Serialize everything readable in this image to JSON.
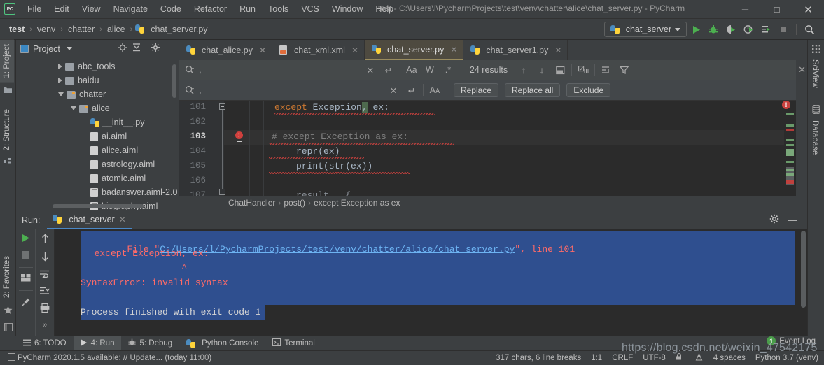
{
  "titlebar": {
    "logo": "PC",
    "menus": [
      "File",
      "Edit",
      "View",
      "Navigate",
      "Code",
      "Refactor",
      "Run",
      "Tools",
      "VCS",
      "Window",
      "Help"
    ],
    "window_title": "test - C:\\Users\\l\\PycharmProjects\\test\\venv\\chatter\\alice\\chat_server.py - PyCharm",
    "minimize": "─",
    "maximize": "□",
    "close": "✕"
  },
  "navbar": {
    "crumbs": [
      "test",
      "venv",
      "chatter",
      "alice",
      "chat_server.py"
    ],
    "separator": "›",
    "run_config": "chat_server",
    "tools": [
      "run-icon",
      "debug-icon",
      "run-coverage-icon",
      "profile-icon",
      "run-with-console-icon",
      "stop-icon",
      "search-everywhere-icon"
    ]
  },
  "left_strip": {
    "project_tab": "1: Project",
    "structure_tab": "2: Structure",
    "favorites_tab": "2: Favorites"
  },
  "project_panel": {
    "title": "Project",
    "header_icons": [
      "locate-icon",
      "collapse-all-icon",
      "settings-icon",
      "hide-icon"
    ],
    "tree": [
      {
        "label": "abc_tools",
        "indent": 2,
        "arrow": "right",
        "icon": "folder-icon"
      },
      {
        "label": "baidu",
        "indent": 2,
        "arrow": "right",
        "icon": "folder-icon"
      },
      {
        "label": "chatter",
        "indent": 2,
        "arrow": "down",
        "icon": "source-folder-icon"
      },
      {
        "label": "alice",
        "indent": 3,
        "arrow": "down",
        "icon": "source-folder-icon"
      },
      {
        "label": "__init__.py",
        "indent": 4,
        "arrow": "none",
        "icon": "python-file-icon"
      },
      {
        "label": "ai.aiml",
        "indent": 4,
        "arrow": "none",
        "icon": "aiml-file-icon"
      },
      {
        "label": "alice.aiml",
        "indent": 4,
        "arrow": "none",
        "icon": "aiml-file-icon"
      },
      {
        "label": "astrology.aiml",
        "indent": 4,
        "arrow": "none",
        "icon": "aiml-file-icon"
      },
      {
        "label": "atomic.aiml",
        "indent": 4,
        "arrow": "none",
        "icon": "aiml-file-icon"
      },
      {
        "label": "badanswer.aiml-2.0",
        "indent": 4,
        "arrow": "none",
        "icon": "aiml-file-icon"
      },
      {
        "label": "biography.aiml",
        "indent": 4,
        "arrow": "none",
        "icon": "aiml-file-icon"
      }
    ]
  },
  "editor_tabs": [
    {
      "label": "chat_alice.py",
      "icon": "python-file-icon",
      "active": false
    },
    {
      "label": "chat_xml.xml",
      "icon": "xml-file-icon",
      "active": false
    },
    {
      "label": "chat_server.py",
      "icon": "python-file-icon",
      "active": true
    },
    {
      "label": "chat_server1.py",
      "icon": "python-file-icon",
      "active": false
    }
  ],
  "find_bar": {
    "search_value": ",",
    "search_placeholder": "",
    "match_case": "Aa",
    "words": "W",
    "regex": ".*",
    "results": "24 results",
    "prev": "↑",
    "next": "↓",
    "preserve_case": "Aᴀ"
  },
  "replace_bar": {
    "replace_value": ",",
    "replace_btn": "Replace",
    "replace_all_btn": "Replace all",
    "exclude_btn": "Exclude"
  },
  "editor": {
    "lines": [
      {
        "num": "101",
        "text": "except Exception, ex:",
        "current": false
      },
      {
        "num": "102",
        "text": "",
        "current": false
      },
      {
        "num": "103",
        "text": "# except Exception as ex:",
        "current": true
      },
      {
        "num": "104",
        "text": "repr(ex)",
        "current": false
      },
      {
        "num": "105",
        "text": "print(str(ex))",
        "current": false
      },
      {
        "num": "106",
        "text": "",
        "current": false
      },
      {
        "num": "107",
        "text": "result = {",
        "current": false
      }
    ],
    "breadcrumbs": [
      "ChatHandler",
      "post()",
      "except Exception as ex"
    ],
    "breadcrumb_sep": "›"
  },
  "right_strip": {
    "sciview_tab": "SciView",
    "database_tab": "Database"
  },
  "run_panel": {
    "label": "Run:",
    "tab": "chat_server",
    "console": [
      {
        "text": "  File \"C:/Users/l/PycharmProjects/test/venv/chatter/alice/chat_server.py\", line 101",
        "kind": "error-file"
      },
      {
        "text": "    except Exception, ex:",
        "kind": "error"
      },
      {
        "text": "                    ^",
        "kind": "error"
      },
      {
        "text": "SyntaxError: invalid syntax",
        "kind": "error"
      },
      {
        "text": "",
        "kind": "blank"
      },
      {
        "text": "Process finished with exit code 1",
        "kind": "info"
      }
    ],
    "link_text": "C:/Users/l/PycharmProjects/test/venv/chatter/alice/chat_server.py",
    "line_ref": "\", line 101",
    "file_prefix": "  File \"",
    "sidebar_icons": [
      "rerun-icon",
      "stop-icon",
      "layout-icon",
      "pin-icon",
      "up-icon",
      "down-icon",
      "soft-wrap-icon",
      "scroll-to-end-icon",
      "print-icon",
      "more-icon"
    ]
  },
  "bottom_tabs": [
    {
      "label": "6: TODO",
      "icon": "todo-icon",
      "active": false
    },
    {
      "label": "4: Run",
      "icon": "run-icon",
      "active": true
    },
    {
      "label": "5: Debug",
      "icon": "debug-icon",
      "active": false
    },
    {
      "label": "Python Console",
      "icon": "python-icon",
      "active": false
    },
    {
      "label": "Terminal",
      "icon": "terminal-icon",
      "active": false
    }
  ],
  "event_log": {
    "label": "Event Log",
    "count": "1"
  },
  "status_bar": {
    "message": "PyCharm 2020.1.5 available: // Update... (today 11:00)",
    "chars": "317 chars, 6 line breaks",
    "caret": "1:1",
    "line_sep": "CRLF",
    "encoding": "UTF-8",
    "indent": "4 spaces",
    "interpreter": "Python 3.7 (venv)"
  },
  "watermark": "https://blog.csdn.net/weixin_47542175"
}
